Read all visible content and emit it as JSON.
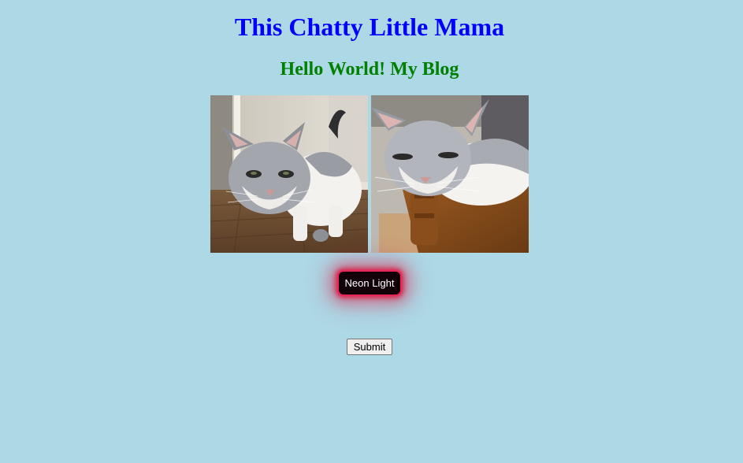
{
  "header": {
    "site_title": "This Chatty Little Mama",
    "blog_heading": "Hello World! My Blog"
  },
  "gallery": {
    "photos": [
      {
        "subject": "grey-and-white cat standing on wooden floor"
      },
      {
        "subject": "grey-and-white cat lying on wooden furniture"
      }
    ]
  },
  "buttons": {
    "neon_label": "Neon Light",
    "submit_label": "Submit"
  },
  "colors": {
    "background": "#add8e6",
    "title": "#0000ff",
    "heading": "#008000",
    "neon_glow": "#dc143c",
    "neon_fill": "#120008"
  }
}
